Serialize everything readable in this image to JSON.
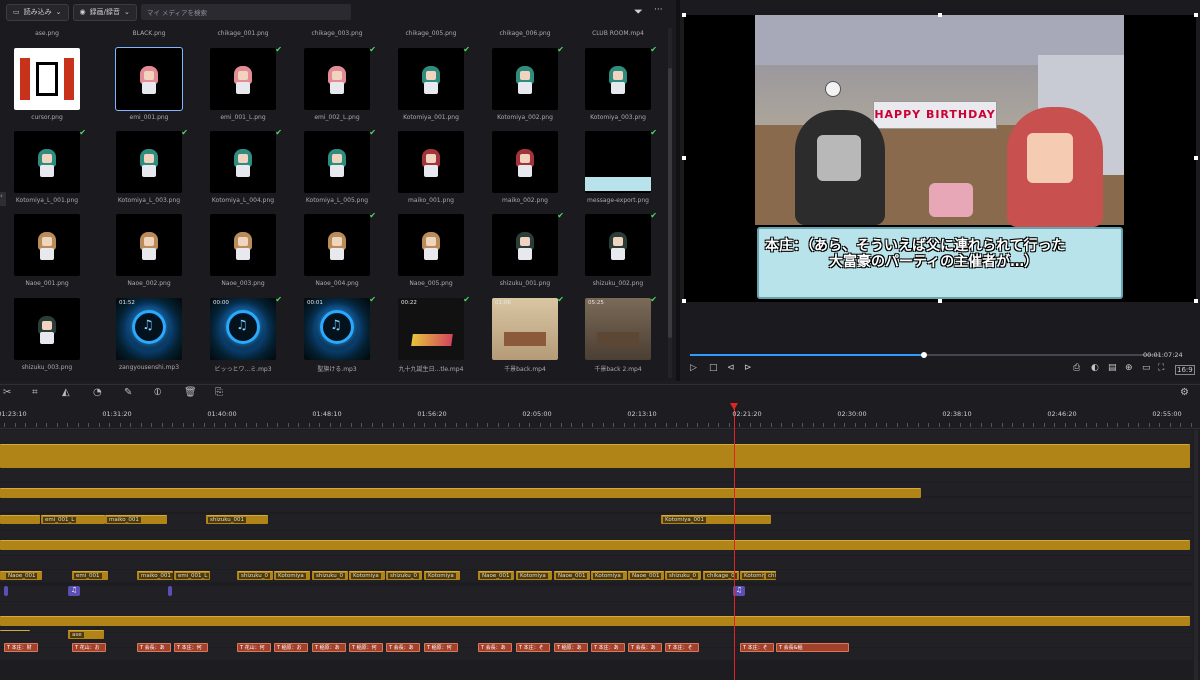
{
  "media": {
    "import_label": "読み込み",
    "record_label": "録画/録音",
    "search_placeholder": "マイ メディアを検索",
    "top_row": [
      "ase.png",
      "BLACK.png",
      "chikage_001.png",
      "chikage_003.png",
      "chikage_005.png",
      "chikage_006.png",
      "CLUB ROOM.mp4"
    ],
    "rows": [
      [
        {
          "name": "cursor.png",
          "kind": "cursor",
          "check": false
        },
        {
          "name": "emi_001.png",
          "kind": "char",
          "hair": "#e58b95",
          "check": false,
          "selected": true
        },
        {
          "name": "emi_001_L.png",
          "kind": "char",
          "hair": "#e58b95",
          "check": true
        },
        {
          "name": "emi_002_L.png",
          "kind": "char",
          "hair": "#e58b95",
          "check": true
        },
        {
          "name": "Kotomiya_001.png",
          "kind": "char",
          "hair": "#2f8d80",
          "check": true
        },
        {
          "name": "Kotomiya_002.png",
          "kind": "char",
          "hair": "#2f8d80",
          "check": true
        },
        {
          "name": "Kotomiya_003.png",
          "kind": "char",
          "hair": "#2f8d80",
          "check": true
        }
      ],
      [
        {
          "name": "Kotomiya_L_001.png",
          "kind": "char",
          "hair": "#2f8d80",
          "check": true
        },
        {
          "name": "Kotomiya_L_003.png",
          "kind": "char",
          "hair": "#2f8d80",
          "check": true
        },
        {
          "name": "Kotomiya_L_004.png",
          "kind": "char",
          "hair": "#2f8d80",
          "check": true
        },
        {
          "name": "Kotomiya_L_005.png",
          "kind": "char",
          "hair": "#2f8d80",
          "check": true
        },
        {
          "name": "maiko_001.png",
          "kind": "char",
          "hair": "#a3343a",
          "check": false
        },
        {
          "name": "maiko_002.png",
          "kind": "char",
          "hair": "#a3343a",
          "check": false
        },
        {
          "name": "message-export.png",
          "kind": "message",
          "check": true
        }
      ],
      [
        {
          "name": "Naoe_001.png",
          "kind": "char",
          "hair": "#b98c5a",
          "check": false
        },
        {
          "name": "Naoe_002.png",
          "kind": "char",
          "hair": "#b98c5a",
          "check": false
        },
        {
          "name": "Naoe_003.png",
          "kind": "char",
          "hair": "#b98c5a",
          "check": false
        },
        {
          "name": "Naoe_004.png",
          "kind": "char",
          "hair": "#b98c5a",
          "check": true
        },
        {
          "name": "Naoe_005.png",
          "kind": "char",
          "hair": "#b98c5a",
          "check": false
        },
        {
          "name": "shizuku_001.png",
          "kind": "char",
          "hair": "#2b3d38",
          "check": true
        },
        {
          "name": "shizuku_002.png",
          "kind": "char",
          "hair": "#2b3d38",
          "check": true
        }
      ],
      [
        {
          "name": "shizuku_003.png",
          "kind": "char",
          "hair": "#2b3d38",
          "check": false
        },
        {
          "name": "zangyousenshi.mp3",
          "kind": "audio",
          "dur": "01:52",
          "check": false
        },
        {
          "name": "ビッっとワ...ミ.mp3",
          "kind": "audio",
          "dur": "00:00",
          "check": true
        },
        {
          "name": "聖旗ける.mp3",
          "kind": "audio",
          "dur": "00:01",
          "check": true
        },
        {
          "name": "九十九誕生日...tle.mp4",
          "kind": "video",
          "dur": "00:22",
          "check": true
        },
        {
          "name": "千景back.mp4",
          "kind": "room",
          "dur": "01:06",
          "check": true
        },
        {
          "name": "千景back 2.mp4",
          "kind": "room2",
          "dur": "05:25",
          "check": true
        }
      ]
    ]
  },
  "preview": {
    "banner": "HAPPY BIRTHDAY",
    "subtitle_line1": "本庄：（あら、そういえば父に連れられて行った",
    "subtitle_line2": "大富豪のパーティの主催者が…）",
    "timecode": "00:01:07:24",
    "progress": 0.5
  },
  "timeline": {
    "ruler": [
      "01:23:10",
      "01:31:20",
      "01:40:00",
      "01:48:10",
      "01:56:20",
      "02:05:00",
      "02:13:10",
      "02:21:20",
      "02:30:00",
      "02:38:10",
      "02:46:20",
      "02:55:00"
    ],
    "playhead": "02:21:20",
    "track3_clips": [
      "emi_001_L",
      "maiko_001",
      "shizuku_001",
      "Kotomiya_001"
    ],
    "track5_clips": [
      "Naoe_001",
      "emi_001",
      "maiko_001",
      "emi_001_L",
      "shizuku_0",
      "Kotomiya",
      "shizuku_0",
      "Kotomiya",
      "shizuku_0",
      "Kotomiya",
      "Naoe_001",
      "Kotomiya",
      "Naoe_001",
      "Kotomiya",
      "Naoe_001",
      "shizuku_0",
      "chikage_0",
      "Kotomiya",
      "chikage_0"
    ],
    "track7_clip": "ase",
    "text_clips": [
      "本庄：財",
      "花山：お",
      "会長：あ",
      "本庄：何",
      "花山：何",
      "稲原：お",
      "稲原：あ",
      "稲原：何",
      "会長：あ",
      "稲原：何",
      "会長：あ",
      "本庄：そ",
      "稲原：あ",
      "本庄：あ",
      "会長：あ",
      "本庄：そ",
      "本庄：そ",
      "会長&稲"
    ]
  },
  "colors": {
    "accent": "#2f9bff",
    "clip": "#b08416",
    "text_clip": "#a2402a",
    "playhead": "#e02424",
    "check": "#4cd964"
  }
}
